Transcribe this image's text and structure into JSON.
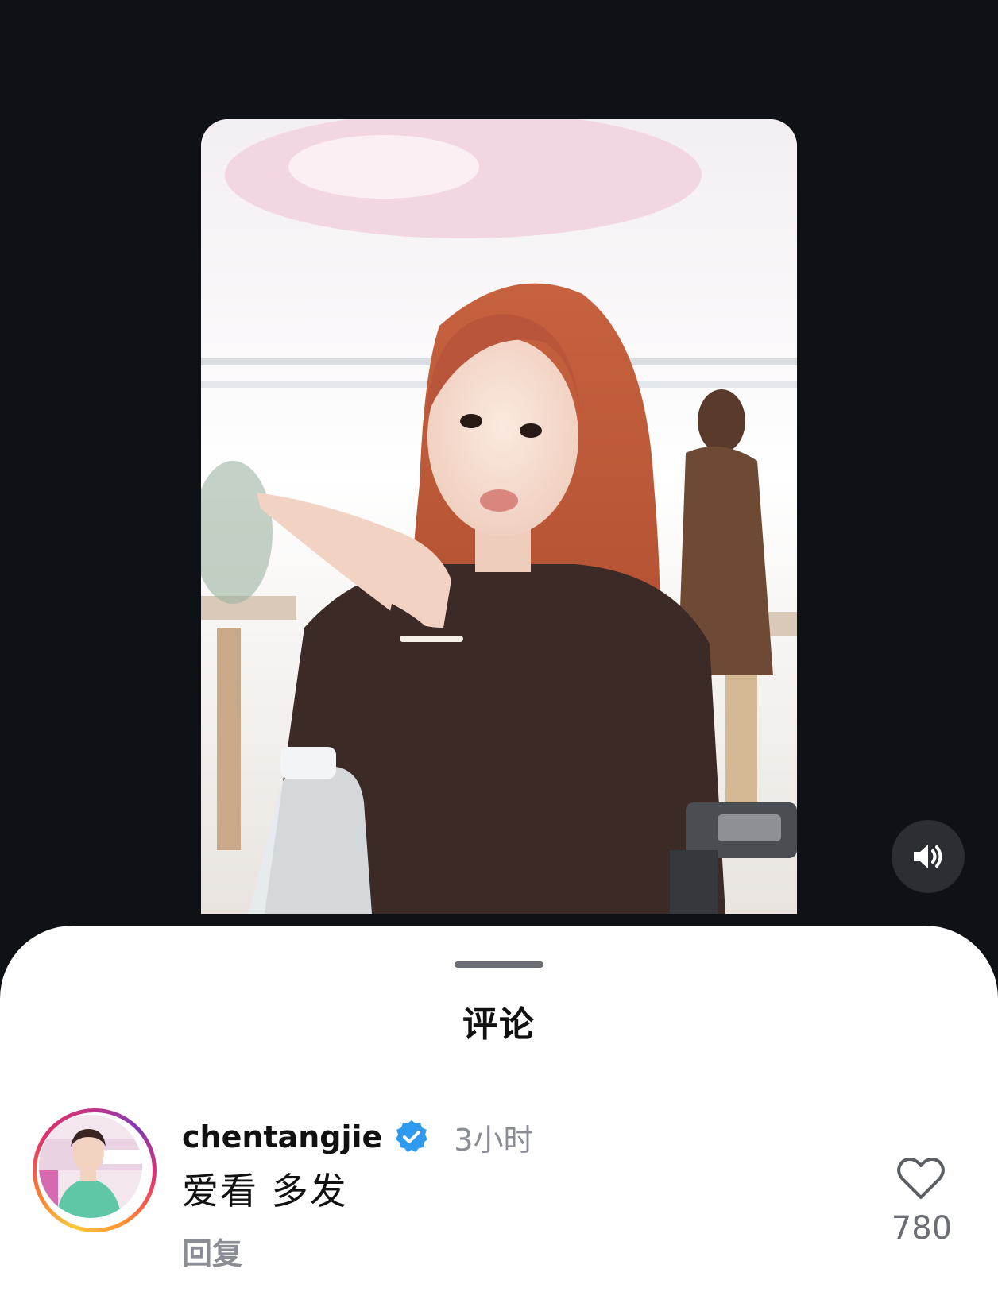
{
  "sheet": {
    "title": "评论"
  },
  "comment": {
    "username": "chentangjie",
    "verified": true,
    "timestamp": "3小时",
    "text": "爱看 多发",
    "reply_label": "回复",
    "like_count": "780"
  },
  "icons": {
    "mute": "speaker-on-icon",
    "like": "heart-outline-icon",
    "verified": "verified-badge-icon"
  },
  "colors": {
    "background": "#0e1116",
    "sheet": "#ffffff",
    "verified_blue": "#2f9bf0",
    "muted_text": "#8a8d93"
  }
}
